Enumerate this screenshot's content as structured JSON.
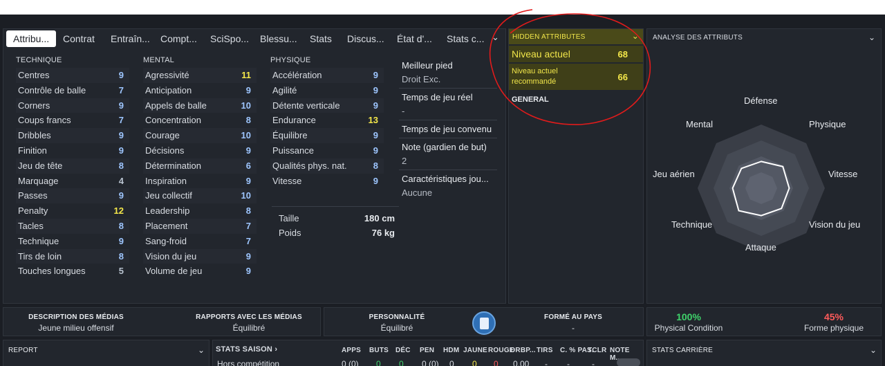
{
  "tabs": [
    {
      "label": "Attribu..."
    },
    {
      "label": "Contrat"
    },
    {
      "label": "Entraîn..."
    },
    {
      "label": "Compt..."
    },
    {
      "label": "SciSpo..."
    },
    {
      "label": "Blessu..."
    },
    {
      "label": "Stats"
    },
    {
      "label": "Discus..."
    },
    {
      "label": "État d'..."
    },
    {
      "label": "Stats c..."
    }
  ],
  "columns": {
    "technique": {
      "title": "TECHNIQUE",
      "rows": [
        {
          "name": "Centres",
          "value": "9"
        },
        {
          "name": "Contrôle de balle",
          "value": "7"
        },
        {
          "name": "Corners",
          "value": "9"
        },
        {
          "name": "Coups francs",
          "value": "7"
        },
        {
          "name": "Dribbles",
          "value": "9"
        },
        {
          "name": "Finition",
          "value": "9"
        },
        {
          "name": "Jeu de tête",
          "value": "8"
        },
        {
          "name": "Marquage",
          "value": "4"
        },
        {
          "name": "Passes",
          "value": "9"
        },
        {
          "name": "Penalty",
          "value": "12"
        },
        {
          "name": "Tacles",
          "value": "8"
        },
        {
          "name": "Technique",
          "value": "9"
        },
        {
          "name": "Tirs de loin",
          "value": "8"
        },
        {
          "name": "Touches longues",
          "value": "5"
        }
      ]
    },
    "mental": {
      "title": "MENTAL",
      "rows": [
        {
          "name": "Agressivité",
          "value": "11"
        },
        {
          "name": "Anticipation",
          "value": "9"
        },
        {
          "name": "Appels de balle",
          "value": "10"
        },
        {
          "name": "Concentration",
          "value": "8"
        },
        {
          "name": "Courage",
          "value": "10"
        },
        {
          "name": "Décisions",
          "value": "9"
        },
        {
          "name": "Détermination",
          "value": "6"
        },
        {
          "name": "Inspiration",
          "value": "9"
        },
        {
          "name": "Jeu collectif",
          "value": "10"
        },
        {
          "name": "Leadership",
          "value": "8"
        },
        {
          "name": "Placement",
          "value": "7"
        },
        {
          "name": "Sang-froid",
          "value": "7"
        },
        {
          "name": "Vision du jeu",
          "value": "9"
        },
        {
          "name": "Volume de jeu",
          "value": "9"
        }
      ]
    },
    "physique": {
      "title": "PHYSIQUE",
      "rows": [
        {
          "name": "Accélération",
          "value": "9"
        },
        {
          "name": "Agilité",
          "value": "9"
        },
        {
          "name": "Détente verticale",
          "value": "9"
        },
        {
          "name": "Endurance",
          "value": "13"
        },
        {
          "name": "Équilibre",
          "value": "9"
        },
        {
          "name": "Puissance",
          "value": "9"
        },
        {
          "name": "Qualités phys. nat.",
          "value": "8"
        },
        {
          "name": "Vitesse",
          "value": "9"
        }
      ]
    }
  },
  "physical": {
    "height_label": "Taille",
    "height_value": "180 cm",
    "weight_label": "Poids",
    "weight_value": "76 kg"
  },
  "info": [
    {
      "label": "Meilleur pied",
      "value": "Droit Exc."
    },
    {
      "label": "Temps de jeu réel",
      "value": "-"
    },
    {
      "label": "Temps de jeu convenu",
      "value": ""
    },
    {
      "label": "Note (gardien de but)",
      "value": "2"
    },
    {
      "label": "Caractéristiques jou...",
      "value": "Aucune"
    }
  ],
  "hidden": {
    "title": "HIDDEN ATTRIBUTES",
    "current_label": "Niveau actuel",
    "current_value": "68",
    "recommended_label": "Niveau actuel recommandé",
    "recommended_value": "66",
    "general": "GENERAL"
  },
  "radar": {
    "title": "ANALYSE DES ATTRIBUTS",
    "labels": {
      "defense": "Défense",
      "physique": "Physique",
      "vitesse": "Vitesse",
      "vision": "Vision du jeu",
      "attaque": "Attaque",
      "technique": "Technique",
      "aerien": "Jeu aérien",
      "mental": "Mental"
    },
    "values": {
      "defense": 0.42,
      "physique": 0.48,
      "vitesse": 0.44,
      "vision": 0.45,
      "attaque": 0.43,
      "technique": 0.5,
      "aerien": 0.45,
      "mental": 0.44
    }
  },
  "bottom": {
    "media_desc_title": "DESCRIPTION DES MÉDIAS",
    "media_desc_value": "Jeune milieu offensif",
    "media_rel_title": "RAPPORTS AVEC LES MÉDIAS",
    "media_rel_value": "Équilibré",
    "personality_title": "PERSONNALITÉ",
    "personality_value": "Équilibré",
    "formed_title": "FORMÉ AU PAYS",
    "formed_value": "-",
    "condition_pct": "100%",
    "condition_label": "Physical Condition",
    "form_pct": "45%",
    "form_label": "Forme physique",
    "condition_color": "#3fd36b",
    "form_color": "#ff5b5b"
  },
  "lower": {
    "report_title": "REPORT",
    "stats_title": "STATS SAISON",
    "stats_headers": [
      "APPS",
      "BUTS",
      "DÉC",
      "PEN",
      "HDM",
      "JAUNE",
      "ROUGE",
      "DRBP...",
      "TIRS",
      "C. % PAS.",
      "TCLR",
      "NOTE M..."
    ],
    "stats_row_label": "Hors compétition",
    "stats_values": [
      "0 (0)",
      "0",
      "0",
      "0 (0)",
      "0",
      "0",
      "0",
      "0.00",
      "-",
      "-",
      "-"
    ],
    "career_title": "STATS CARRIÈRE"
  }
}
